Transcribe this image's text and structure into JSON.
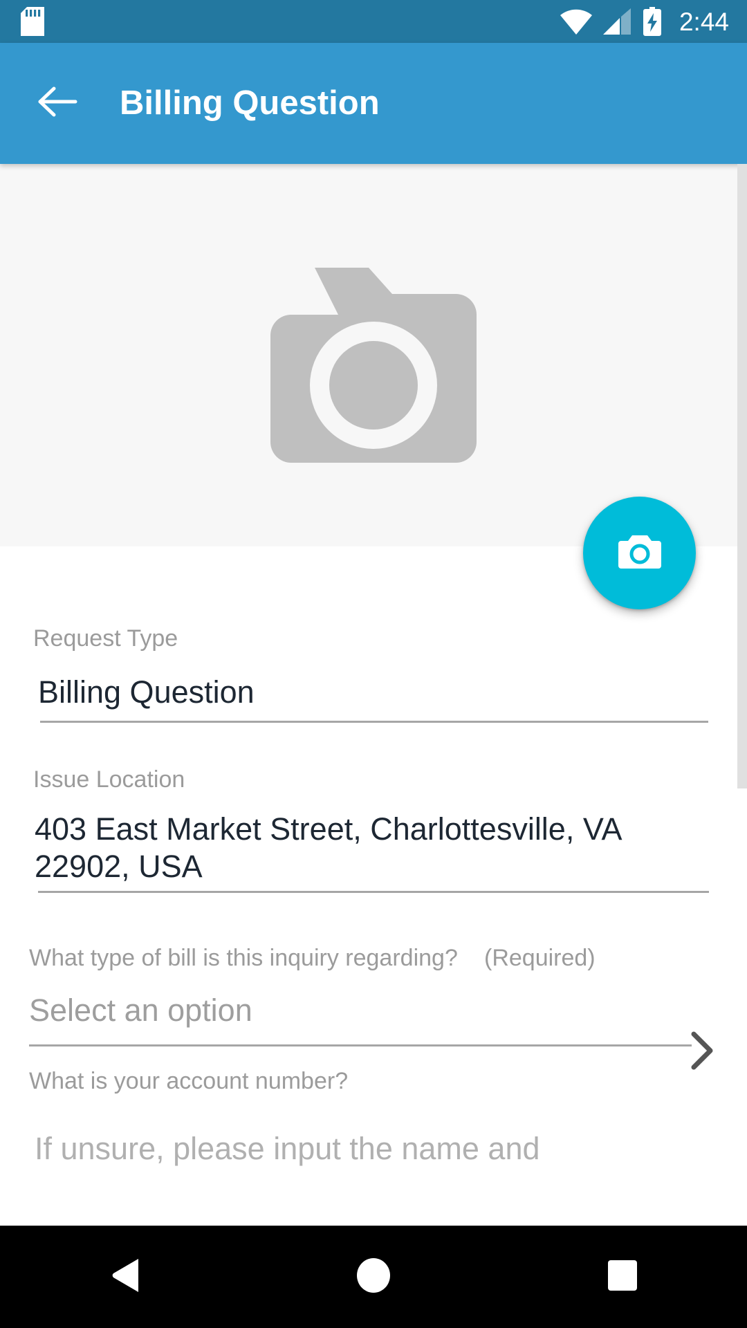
{
  "status_bar": {
    "clock": "2:44",
    "icons": {
      "sd_card": "sd-card-icon",
      "wifi": "wifi-icon",
      "cellular": "cellular-signal-icon",
      "battery": "battery-charging-icon"
    },
    "background_color": "#2378a0"
  },
  "app_bar": {
    "title": "Billing Question",
    "back_icon": "arrow-left-icon",
    "background_color": "#3498ce"
  },
  "photo_area": {
    "placeholder_icon": "camera-placeholder-icon",
    "background_color": "#f7f7f7",
    "placeholder_color": "#bfbfbf"
  },
  "fab": {
    "icon": "camera-icon",
    "color": "#00bcd9"
  },
  "form": {
    "fields": [
      {
        "label": "Request Type",
        "value": "Billing Question",
        "type": "text"
      },
      {
        "label": "Issue Location",
        "value_line1": "403 East Market Street, Charlottesville, VA",
        "value_line2": "22902, USA",
        "type": "multiline"
      },
      {
        "label": "What type of bill is this inquiry regarding?",
        "required_tag": "(Required)",
        "placeholder": "Select an option",
        "chevron_icon": "chevron-right-icon",
        "type": "select"
      },
      {
        "label": "What is your account number?",
        "helper": "If unsure, please input the name and",
        "type": "text"
      }
    ]
  },
  "nav_bar": {
    "back": "nav-back-triangle-icon",
    "home": "nav-home-circle-icon",
    "recents": "nav-recents-square-icon",
    "background_color": "#000000"
  },
  "scrollbar": {
    "color": "#e0e0e0"
  }
}
